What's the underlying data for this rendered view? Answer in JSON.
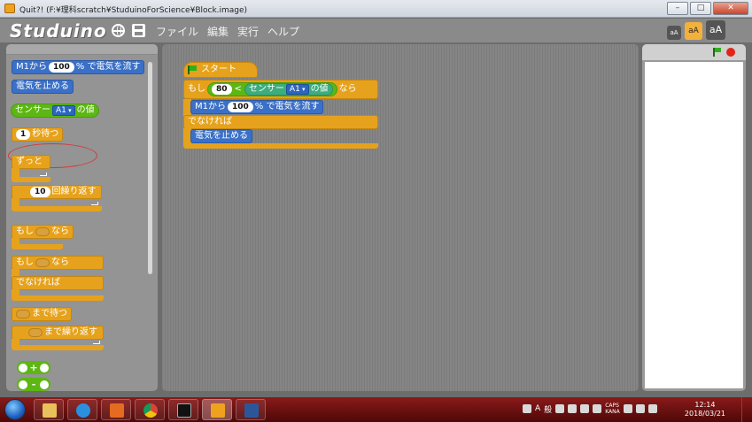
{
  "window": {
    "title": "Quit?! (F:¥理科scratch¥StuduinoForScience¥Block.image)",
    "minimize": "–",
    "maximize": "□",
    "close": "✕"
  },
  "app": {
    "logo": "Studuino",
    "menu": [
      "ファイル",
      "編集",
      "実行",
      "ヘルプ"
    ],
    "size_buttons": [
      "aA",
      "aA",
      "aA"
    ]
  },
  "palette": {
    "motor_block": {
      "prefix": "M1から",
      "value": "100",
      "suffix": "% で電気を流す"
    },
    "stop_block": "電気を止める",
    "sensor_block": {
      "prefix": "センサー",
      "port": "A1",
      "suffix": "の値"
    },
    "wait_block": {
      "value": "1",
      "suffix": "秒待つ"
    },
    "forever_block": "ずっと",
    "repeat_block": {
      "value": "10",
      "suffix": "回繰り返す"
    },
    "if_block": {
      "prefix": "もし",
      "suffix": "なら"
    },
    "ifelse_block": {
      "prefix": "もし",
      "suffix": "なら",
      "else": "でなければ"
    },
    "wait_until_block": "まで待つ",
    "repeat_until_block": "まで繰り返す",
    "add_op": "+",
    "sub_op": "-"
  },
  "script": {
    "hat": "スタート",
    "if": {
      "prefix": "もし",
      "value": "80",
      "op": "<",
      "sensor": "センサー",
      "port": "A1",
      "sensor_suffix": "の値",
      "suffix": "なら"
    },
    "motor": {
      "prefix": "M1から",
      "value": "100",
      "suffix": "% で電気を流す"
    },
    "else": "でなければ",
    "stop": "電気を止める"
  },
  "taskbar": {
    "apps": [
      "explorer",
      "internet-explorer",
      "media-player",
      "chrome",
      "command-prompt",
      "studuino",
      "word"
    ],
    "tray": {
      "ime_mode": "A",
      "ime_label": "般",
      "caps": "CAPS",
      "kana": "KANA"
    },
    "clock_time": "12:14",
    "clock_date": "2018/03/21"
  }
}
